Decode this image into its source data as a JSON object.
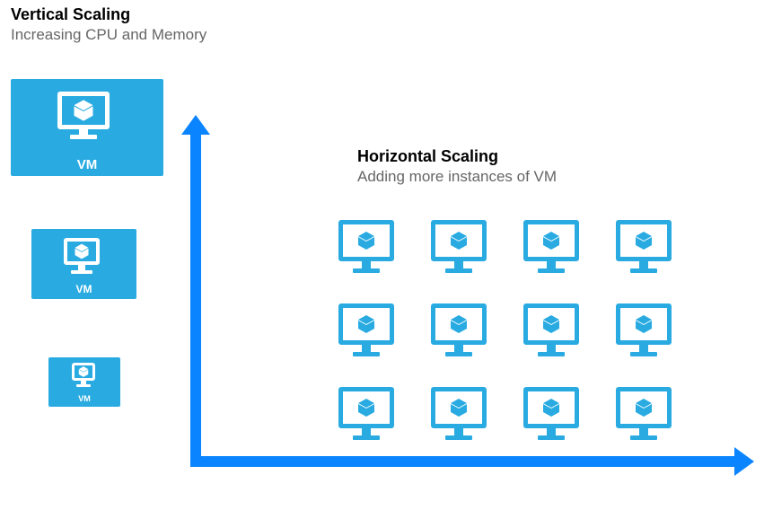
{
  "vertical": {
    "title": "Vertical Scaling",
    "subtitle": "Increasing CPU and Memory",
    "vm_label": "VM",
    "sizes": [
      "large",
      "medium",
      "small"
    ]
  },
  "horizontal": {
    "title": "Horizontal Scaling",
    "subtitle": "Adding more instances of VM",
    "grid": {
      "rows": 3,
      "cols": 4
    }
  },
  "colors": {
    "primary": "#29abe2",
    "arrow": "#0a84ff"
  }
}
